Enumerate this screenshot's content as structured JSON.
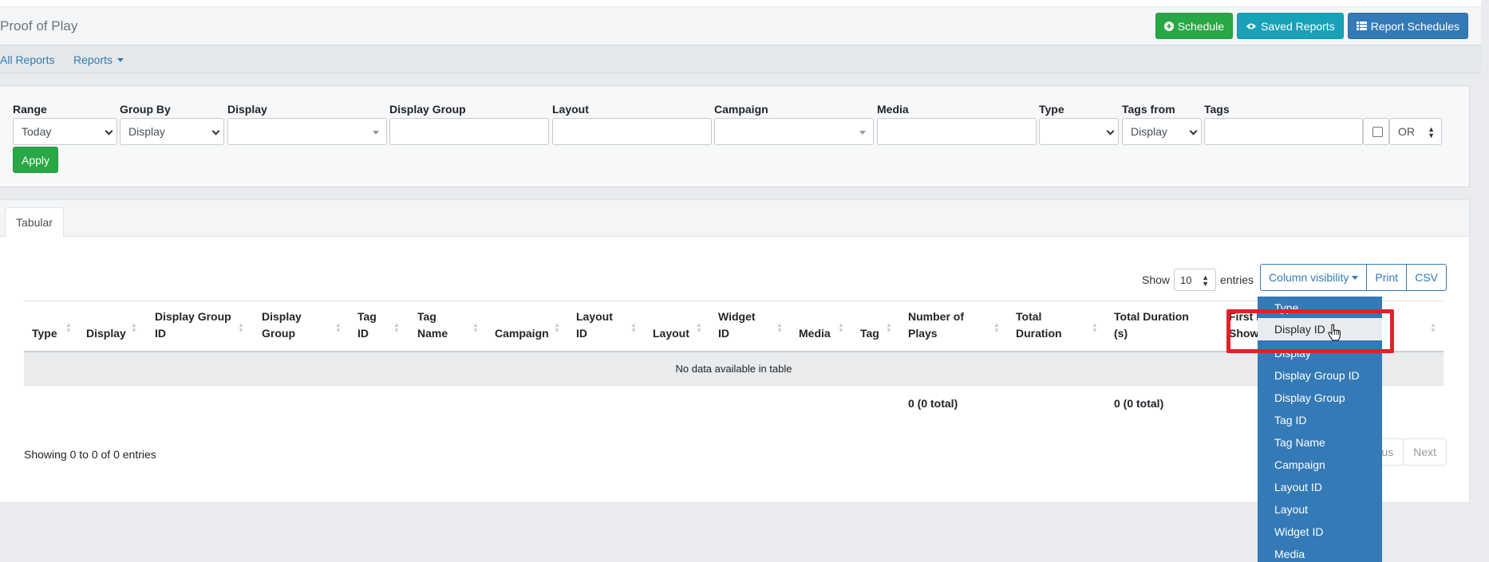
{
  "header": {
    "title": "Proof of Play",
    "buttons": {
      "schedule": "Schedule",
      "saved_reports": "Saved Reports",
      "report_schedules": "Report Schedules"
    }
  },
  "nav": {
    "all_reports": "All Reports",
    "reports": "Reports"
  },
  "filters": {
    "labels": {
      "range": "Range",
      "group_by": "Group By",
      "display": "Display",
      "display_group": "Display Group",
      "layout": "Layout",
      "campaign": "Campaign",
      "media": "Media",
      "type": "Type",
      "tags_from": "Tags from",
      "tags": "Tags"
    },
    "values": {
      "range": "Today",
      "group_by": "Display",
      "display": "",
      "display_group": "",
      "layout": "",
      "campaign": "",
      "media": "",
      "type": "",
      "tags_from": "Display",
      "tags": "",
      "logic": "OR"
    },
    "apply_label": "Apply"
  },
  "tab": "Tabular",
  "table_controls": {
    "show_label": "Show",
    "entries_value": "10",
    "entries_label": "entries",
    "column_visibility": "Column visibility",
    "print": "Print",
    "csv": "CSV"
  },
  "table": {
    "columns": [
      "Type",
      "Display",
      "Display Group ID",
      "Display Group",
      "Tag ID",
      "Tag Name",
      "Campaign",
      "Layout ID",
      "Layout",
      "Widget ID",
      "Media",
      "Tag",
      "Number of Plays",
      "Total Duration",
      "Total Duration (s)",
      "First Played Shown",
      ""
    ],
    "empty_text": "No data available in table",
    "footer": {
      "plays": "0 (0 total)",
      "duration_s": "0 (0 total)"
    },
    "info": "Showing 0 to 0 of 0 entries",
    "pager": {
      "previous": "Previous",
      "next": "Next"
    }
  },
  "column_menu": {
    "items": [
      "Type",
      "Display ID",
      "Display",
      "Display Group ID",
      "Display Group",
      "Tag ID",
      "Tag Name",
      "Campaign",
      "Layout ID",
      "Layout",
      "Widget ID",
      "Media"
    ],
    "highlighted": "Display ID"
  },
  "colors": {
    "accent_blue": "#337ab7",
    "success_green": "#28a745",
    "info_teal": "#17a2b8",
    "highlight_red": "#e3202a"
  }
}
